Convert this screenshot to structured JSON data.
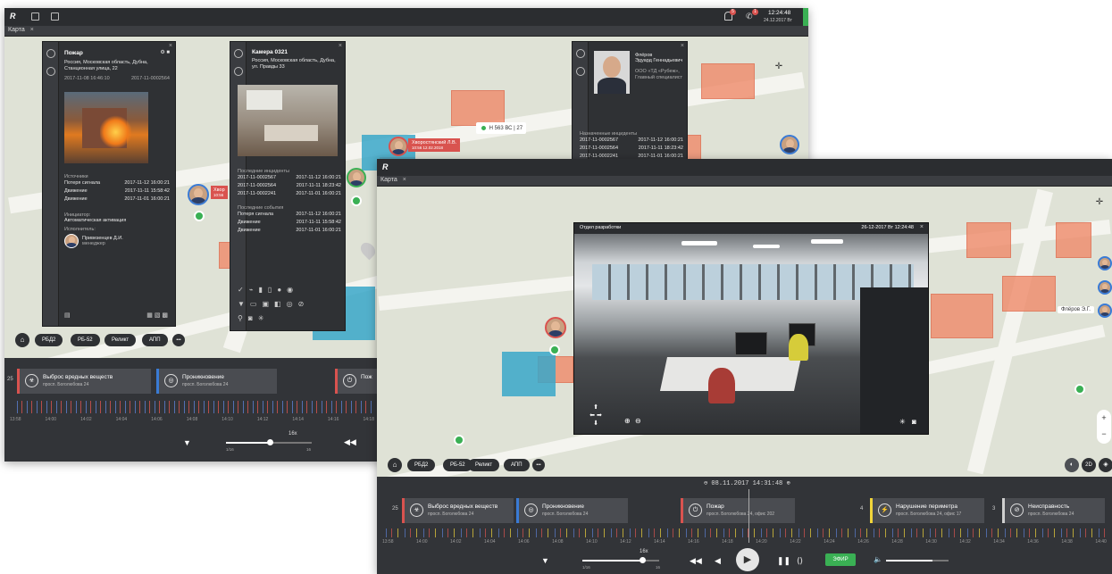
{
  "back_window": {
    "clock_time": "12:24:48",
    "clock_date": "24.12.2017 Вт",
    "notif_badge": "5",
    "call_badge": "1",
    "tab_label": "Карта",
    "tab_close": "×",
    "fire_panel": {
      "title": "Пожар",
      "address": "Россия, Московская область, Дубна, Станционная улица, 22",
      "date": "2017-11-08 16:46:10",
      "id": "2017-11-0002564",
      "sources_label": "Источники",
      "sources": [
        {
          "name": "Потеря сигнала",
          "time": "2017-11-12 16:00:21"
        },
        {
          "name": "Движение",
          "time": "2017-11-11 15:58:42"
        },
        {
          "name": "Движение",
          "time": "2017-11-01 16:00:21"
        }
      ],
      "initiator_label": "Инициатор:",
      "initiator_value": "Автоматическая активация",
      "executor_label": "Исполнитель:",
      "executor_name": "Привезенцев Д.И.",
      "executor_role": "менеджер"
    },
    "camera_panel": {
      "title": "Камера 0321",
      "address": "Россия, Московская область, Дубна, ул. Правды 33",
      "incidents_label": "Последние инциденты",
      "incidents": [
        {
          "id": "2017-11-0002567",
          "time": "2017-11-12 16:00:21"
        },
        {
          "id": "2017-11-0002564",
          "time": "2017-11-11 18:23:42"
        },
        {
          "id": "2017-11-0002241",
          "time": "2017-11-01 16:00:21"
        }
      ],
      "events_label": "Последние события",
      "events": [
        {
          "name": "Потеря сигнала",
          "time": "2017-11-12 16:00:21"
        },
        {
          "name": "Движение",
          "time": "2017-11-11 15:58:42"
        },
        {
          "name": "Движение",
          "time": "2017-11-01 16:00:21"
        }
      ]
    },
    "person_panel": {
      "name_line1": "Флёров",
      "name_line2": "Эдуард Геннадьевич",
      "org": "ООО «ТД «Рубеж», Главный специалист",
      "assigned_label": "Назначенные инциденты",
      "assigned": [
        {
          "id": "2017-11-0002567",
          "time": "2017-11-12 16:00:21"
        },
        {
          "id": "2017-11-0002564",
          "time": "2017-11-11 18:23:42"
        },
        {
          "id": "2017-11-0002241",
          "time": "2017-11-01 16:00:21"
        }
      ]
    },
    "map_labels": {
      "person_tag_name": "Хворостянский Л.В.",
      "person_tag_time": "10:56 12.02.2018",
      "short_tag": "Хвор",
      "short_tag_time": "10:56",
      "vehicle_tag": "Н 563 ВС | 27"
    },
    "pills": [
      "РБД2",
      "РБ-52",
      "Реликт",
      "АПП"
    ],
    "more_label": "•••",
    "timeline_cards": [
      {
        "count": "25",
        "title": "Выброс вредных веществ",
        "addr": "просп. Боголюбова 24"
      },
      {
        "title": "Проникновение",
        "addr": "просп. Боголюбова 24"
      },
      {
        "title": "Пож"
      }
    ],
    "ticks": [
      "13:58",
      "14:00",
      "14:02",
      "14:04",
      "14:06",
      "14:08",
      "14:10",
      "14:12",
      "14:14",
      "14:16",
      "14:18"
    ],
    "speed_label": "16x",
    "speed_min": "1/16",
    "speed_max": "16"
  },
  "front_window": {
    "tab_label": "Карта",
    "tab_close": "×",
    "video": {
      "title": "Отдел разработки",
      "timestamp": "26-12-2017 Вт 12:24:48",
      "close": "×"
    },
    "person_label": "Флёров Э.Г.",
    "pills": [
      "РБД2",
      "РБ-52",
      "Реликт",
      "АПП"
    ],
    "more_label": "•••",
    "view_2d": "2D",
    "zoom_in": "+",
    "zoom_out": "−",
    "timeline_clock": "08.11.2017 14:31:48",
    "timeline_cards": [
      {
        "count": "25",
        "title": "Выброс вредных веществ",
        "addr": "просп. Боголюбова 24",
        "color": "#d9534f"
      },
      {
        "title": "Проникновение",
        "addr": "просп. Боголюбова 24",
        "color": "#3a7bd5"
      },
      {
        "title": "Пожар",
        "addr": "просп. Боголюбова 24, офис 202",
        "color": "#d9534f"
      },
      {
        "count": "4",
        "title": "Нарушение периметра",
        "addr": "просп. Боголюбова 24, офис 17",
        "color": "#f0d43a"
      },
      {
        "count": "3",
        "title": "Неисправность",
        "addr": "просп. Боголюбова 24",
        "color": "#cfcfcf"
      }
    ],
    "ticks": [
      "13:58",
      "14:00",
      "14:02",
      "14:04",
      "14:06",
      "14:08",
      "14:10",
      "14:12",
      "14:14",
      "14:16",
      "14:18",
      "14:20",
      "14:22",
      "14:24",
      "14:26",
      "14:28",
      "14:30",
      "14:32",
      "14:34",
      "14:36",
      "14:38",
      "14:40"
    ],
    "speed_label": "16x",
    "speed_min": "1/16",
    "speed_max": "16",
    "live_label": "ЭФИР"
  },
  "colors": {
    "incident_red": "#d9534f",
    "accent_green": "#3ab054",
    "panel_dark": "#2f3134"
  }
}
